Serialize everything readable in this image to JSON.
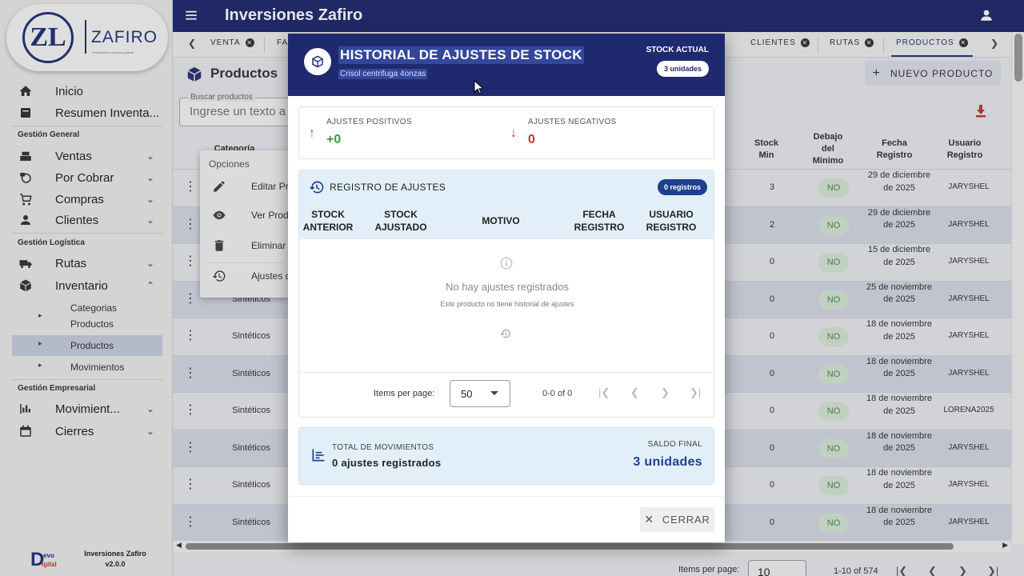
{
  "app": {
    "title": "Inversiones Zafiro"
  },
  "logo": {
    "mark": "ZL",
    "name": "ZAFIRO",
    "tagline": "Inversiones, centros y planta"
  },
  "sidebar": {
    "top_items": [
      {
        "label": "Inicio",
        "icon": "home-icon"
      },
      {
        "label": "Resumen Inventa...",
        "icon": "summary-icon"
      }
    ],
    "section_general": "Gestión General",
    "general_items": [
      {
        "label": "Ventas",
        "icon": "sales-icon"
      },
      {
        "label": "Por Cobrar",
        "icon": "receivables-icon"
      },
      {
        "label": "Compras",
        "icon": "cart-icon"
      },
      {
        "label": "Clientes",
        "icon": "person-icon"
      }
    ],
    "section_logistica": "Gestión Logística",
    "logistica_items": [
      {
        "label": "Rutas",
        "icon": "truck-icon"
      },
      {
        "label": "Inventario",
        "icon": "cube-icon"
      }
    ],
    "inventario_sub": [
      {
        "label": "Categorias Productos"
      },
      {
        "label": "Productos"
      },
      {
        "label": "Movimientos"
      }
    ],
    "section_empresarial": "Gestión Empresarial",
    "empresarial_items": [
      {
        "label": "Movimient...",
        "icon": "movements-icon"
      },
      {
        "label": "Cierres",
        "icon": "calendar-icon"
      }
    ],
    "footer": {
      "brand_top": "evo",
      "brand_bottom": "igital",
      "name": "Inversiones Zafiro",
      "version": "v2.0.0"
    }
  },
  "tabs": [
    {
      "label": "VENTA"
    },
    {
      "label": "FA"
    },
    {
      "label": "CLIENTES"
    },
    {
      "label": "RUTAS"
    },
    {
      "label": "PRODUCTOS"
    }
  ],
  "page": {
    "title": "Productos",
    "new_button": "NUEVO PRODUCTO",
    "search_label": "Buscar productos",
    "search_placeholder": "Ingrese un texto a"
  },
  "table": {
    "headers": {
      "categoria": "Categoría",
      "stock_min": "Stock Min",
      "debajo": "Debajo del Minimo",
      "fecha": "Fecha Registro",
      "usuario": "Usuario Registro"
    },
    "rows": [
      {
        "categoria": "",
        "stock_min": "3",
        "debajo": "NO",
        "fecha": "29 de diciembre de 2025",
        "usuario": "JARYSHEL"
      },
      {
        "categoria": "",
        "stock_min": "2",
        "debajo": "NO",
        "fecha": "29 de diciembre de 2025",
        "usuario": "JARYSHEL"
      },
      {
        "categoria": "",
        "stock_min": "0",
        "debajo": "NO",
        "fecha": "15 de diciembre de 2025",
        "usuario": "JARYSHEL"
      },
      {
        "categoria": "Sintéticos",
        "stock_min": "0",
        "debajo": "NO",
        "fecha": "25 de noviembre de 2025",
        "usuario": "JARYSHEL"
      },
      {
        "categoria": "Sintéticos",
        "stock_min": "0",
        "debajo": "NO",
        "fecha": "18 de noviembre de 2025",
        "usuario": "JARYSHEL"
      },
      {
        "categoria": "Sintéticos",
        "stock_min": "0",
        "debajo": "NO",
        "fecha": "18 de noviembre de 2025",
        "usuario": "JARYSHEL"
      },
      {
        "categoria": "Sintéticos",
        "stock_min": "0",
        "debajo": "NO",
        "fecha": "18 de noviembre de 2025",
        "usuario": "LORENA2025"
      },
      {
        "categoria": "Sintéticos",
        "stock_min": "0",
        "debajo": "NO",
        "fecha": "18 de noviembre de 2025",
        "usuario": "JARYSHEL"
      },
      {
        "categoria": "Sintéticos",
        "stock_min": "0",
        "debajo": "NO",
        "fecha": "18 de noviembre de 2025",
        "usuario": "JARYSHEL"
      },
      {
        "categoria": "Sintéticos",
        "stock_min": "0",
        "debajo": "NO",
        "fecha": "18 de noviembre de 2025",
        "usuario": "JARYSHEL"
      }
    ]
  },
  "options_menu": {
    "title": "Opciones",
    "items": [
      {
        "label": "Editar Pro",
        "icon": "edit-icon"
      },
      {
        "label": "Ver Produ",
        "icon": "eye-icon"
      },
      {
        "label": "Eliminar P",
        "icon": "trash-icon"
      },
      {
        "label": "Ajustes de",
        "icon": "history-icon"
      }
    ]
  },
  "bottom_pagination": {
    "label": "Items per page:",
    "value": "10",
    "range": "1-10 of 574"
  },
  "modal": {
    "title": "HISTORIAL DE AJUSTES DE STOCK",
    "subtitle": "Crisol centrifuga 4onzas",
    "stock_label": "STOCK ACTUAL",
    "stock_value": "3 unidades",
    "positivos_label": "AJUSTES POSITIVOS",
    "positivos_value": "+0",
    "negativos_label": "AJUSTES NEGATIVOS",
    "negativos_value": "0",
    "registro_title": "REGISTRO DE AJUSTES",
    "registro_badge": "0 registros",
    "columns": [
      "STOCK ANTERIOR",
      "STOCK AJUSTADO",
      "MOTIVO",
      "FECHA REGISTRO",
      "USUARIO REGISTRO"
    ],
    "empty_title": "No hay ajustes registrados",
    "empty_sub": "Este producto no tiene historial de ajustes",
    "pag_label": "Items per page:",
    "pag_value": "50",
    "pag_range": "0-0 of 0",
    "total_label": "TOTAL DE MOVIMIENTOS",
    "total_value": "0 ajustes registrados",
    "saldo_label": "SALDO FINAL",
    "saldo_value": "3 unidades",
    "close_label": "CERRAR"
  },
  "colors": {
    "primary": "#1f2a6e",
    "positive": "#3a9a3a",
    "negative": "#c0392b",
    "accent": "#1f3f8f"
  }
}
